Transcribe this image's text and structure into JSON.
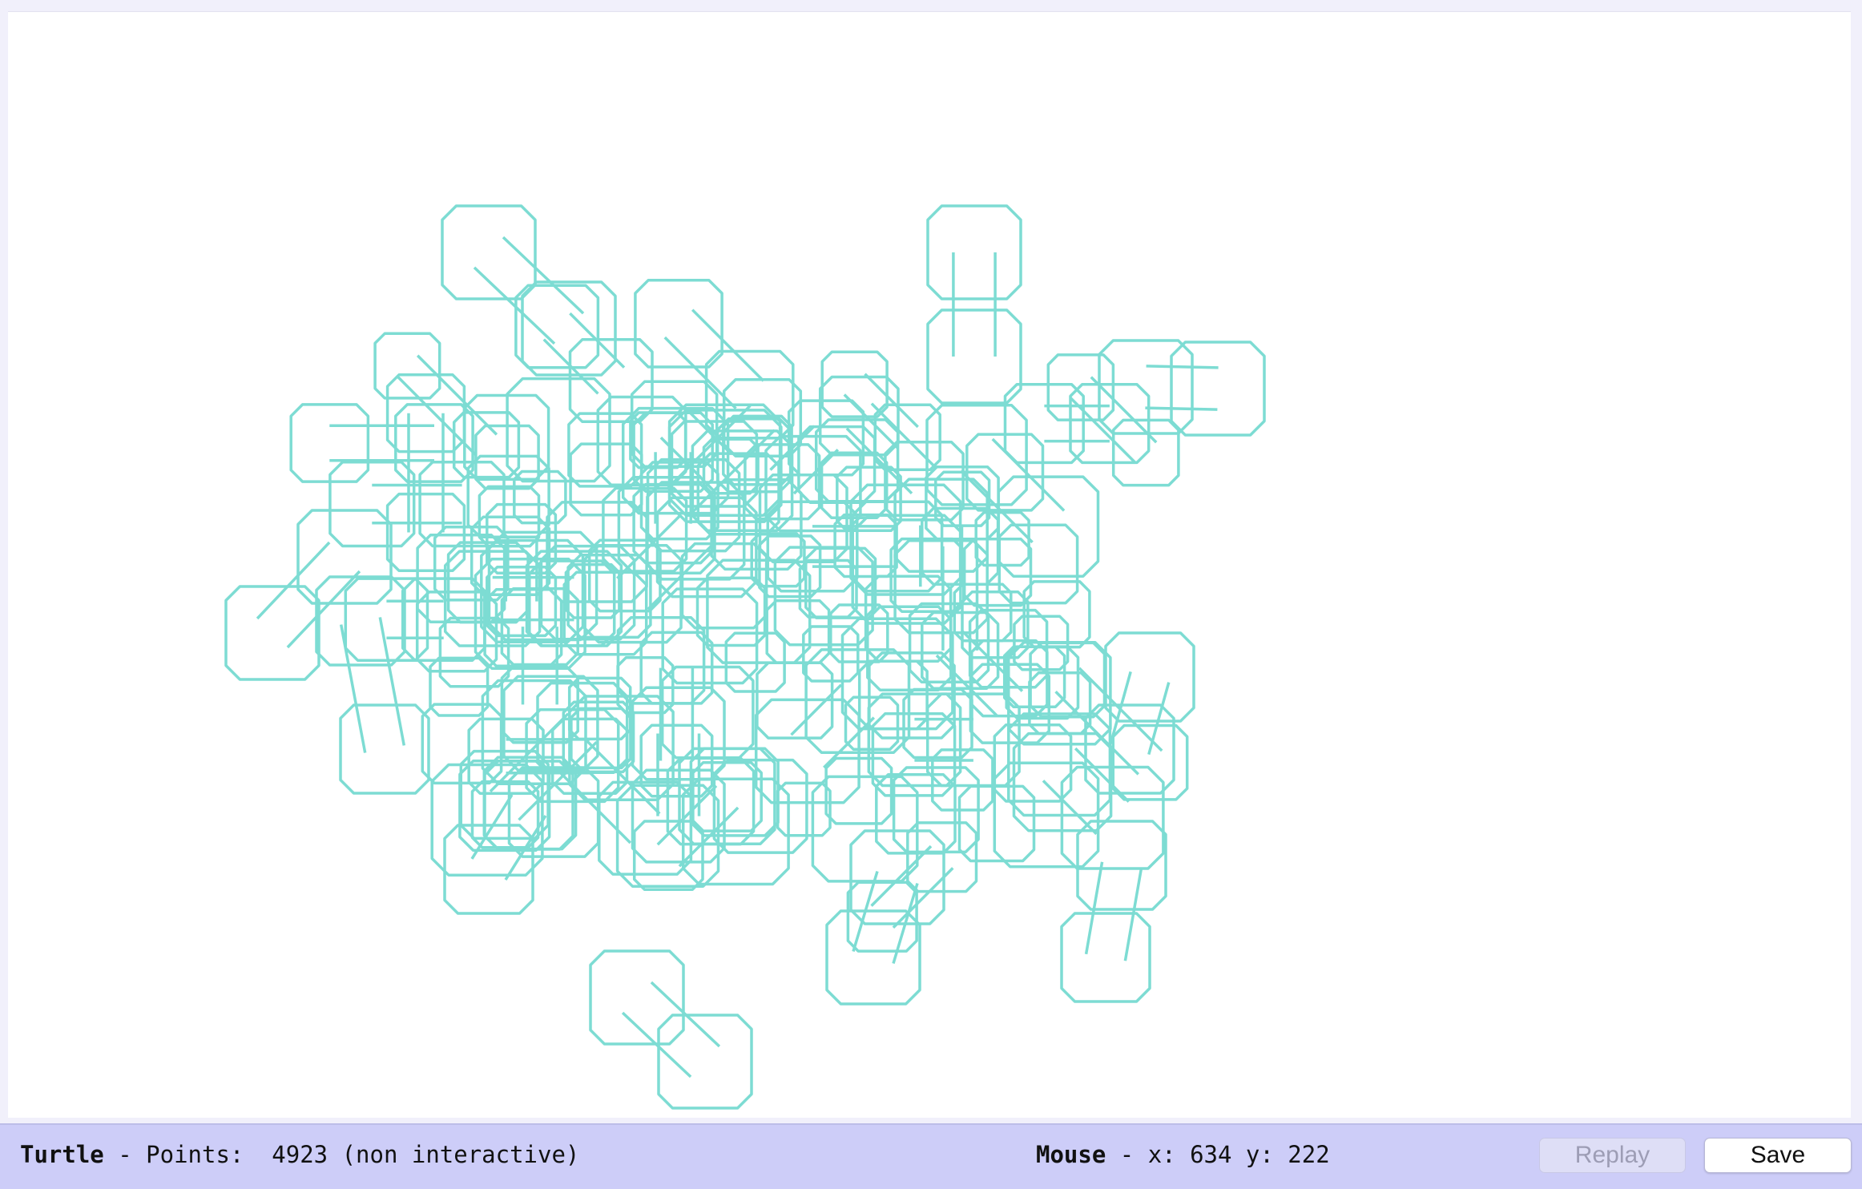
{
  "canvas": {
    "stroke_color": "#7ddcd3",
    "background_color": "#ffffff"
  },
  "status_bar": {
    "background_color": "#cdcdf8",
    "turtle_label": "Turtle",
    "points_text": " - Points:  4923 (non interactive)",
    "mouse_label": "Mouse",
    "mouse_text": " - x: 634 y: 222"
  },
  "buttons": {
    "replay_label": "Replay",
    "save_label": "Save"
  }
}
